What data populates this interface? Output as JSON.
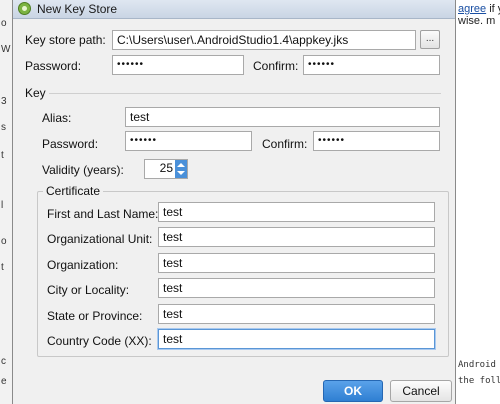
{
  "background": {
    "left_fragments": [
      "o",
      "W",
      "3",
      "s",
      "t",
      "l",
      "o",
      "t",
      "c",
      "e"
    ],
    "right_note_1_link": "agree",
    "right_note_1_rest": " if y",
    "right_note_2": "wise. m",
    "right_mono_1": "Android S",
    "right_mono_2": "the follo"
  },
  "window": {
    "title": "New Key Store",
    "icon": "android-studio-icon"
  },
  "keystore": {
    "path_label": "Key store path:",
    "path_value": "C:\\Users\\user\\.AndroidStudio1.4\\appkey.jks",
    "browse_label": "...",
    "password_label": "Password:",
    "password_value": "••••••",
    "confirm_label": "Confirm:",
    "confirm_value": "••••••"
  },
  "key": {
    "section_label": "Key",
    "alias_label": "Alias:",
    "alias_value": "test",
    "password_label": "Password:",
    "password_value": "••••••",
    "confirm_label": "Confirm:",
    "confirm_value": "••••••",
    "validity_label": "Validity (years):",
    "validity_value": "25"
  },
  "certificate": {
    "section_label": "Certificate",
    "fields": [
      {
        "label": "First and Last Name:",
        "value": "test"
      },
      {
        "label": "Organizational Unit:",
        "value": "test"
      },
      {
        "label": "Organization:",
        "value": "test"
      },
      {
        "label": "City or Locality:",
        "value": "test"
      },
      {
        "label": "State or Province:",
        "value": "test"
      },
      {
        "label": "Country Code (XX):",
        "value": "test"
      }
    ]
  },
  "buttons": {
    "ok": "OK",
    "cancel": "Cancel"
  },
  "colors": {
    "accent": "#2f7fd2",
    "focus": "#5a96d6"
  }
}
